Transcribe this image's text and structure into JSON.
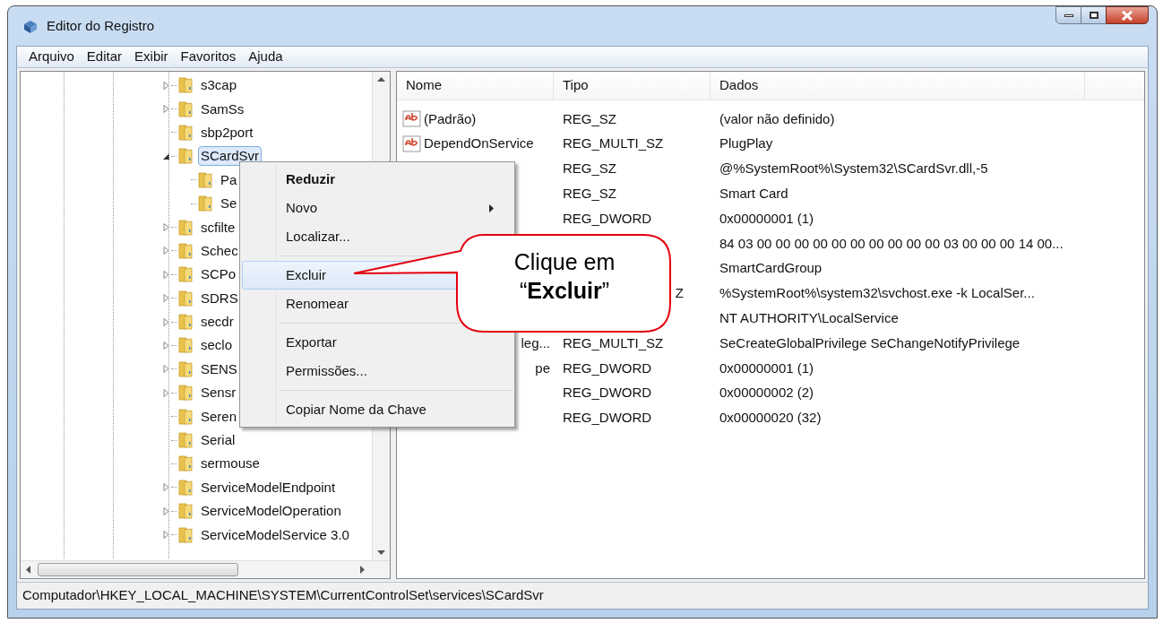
{
  "window": {
    "title": "Editor do Registro"
  },
  "menu_bar": [
    "Arquivo",
    "Editar",
    "Exibir",
    "Favoritos",
    "Ajuda"
  ],
  "tree": [
    {
      "label": "s3cap",
      "expanded": false,
      "selected": false
    },
    {
      "label": "SamSs",
      "expanded": false,
      "selected": false
    },
    {
      "label": "sbp2port",
      "selected": false
    },
    {
      "label": "SCardSvr",
      "expanded": true,
      "selected": true,
      "children": [
        {
          "label": "Pa",
          "selected": false
        },
        {
          "label": "Se",
          "selected": false
        }
      ]
    },
    {
      "label": "scfilte",
      "expanded": false,
      "selected": false
    },
    {
      "label": "Schec",
      "expanded": false,
      "selected": false
    },
    {
      "label": "SCPo",
      "expanded": false,
      "selected": false
    },
    {
      "label": "SDRS",
      "expanded": false,
      "selected": false
    },
    {
      "label": "secdr",
      "expanded": false,
      "selected": false
    },
    {
      "label": "seclo",
      "expanded": false,
      "selected": false
    },
    {
      "label": "SENS",
      "expanded": false,
      "selected": false
    },
    {
      "label": "Sensr",
      "expanded": false,
      "selected": false
    },
    {
      "label": "Seren",
      "selected": false
    },
    {
      "label": "Serial",
      "selected": false
    },
    {
      "label": "sermouse",
      "selected": false
    },
    {
      "label": "ServiceModelEndpoint",
      "expanded": false,
      "selected": false
    },
    {
      "label": "ServiceModelOperation",
      "expanded": false,
      "selected": false
    },
    {
      "label": "ServiceModelService 3.0",
      "expanded": false,
      "selected": false
    }
  ],
  "values": {
    "columns": [
      "Nome",
      "Tipo",
      "Dados"
    ],
    "rows": [
      {
        "kind": "string",
        "name": "(Padrão)",
        "type": "REG_SZ",
        "data": "(valor não definido)"
      },
      {
        "kind": "string",
        "name": "DependOnService",
        "type": "REG_MULTI_SZ",
        "data": "PlugPlay"
      },
      {
        "type": "REG_SZ",
        "data": "@%SystemRoot%\\System32\\SCardSvr.dll,-5"
      },
      {
        "type": "REG_SZ",
        "data": "Smart Card"
      },
      {
        "type": "REG_DWORD",
        "data": "0x00000001 (1)"
      },
      {
        "data": "84 03 00 00 00 00 00 00 00 00 00 00 03 00 00 00 14 00..."
      },
      {
        "data": "SmartCardGroup"
      },
      {
        "type": "Z",
        "data": "%SystemRoot%\\system32\\svchost.exe -k LocalSer..."
      },
      {
        "data": "NT AUTHORITY\\LocalService"
      },
      {
        "name": "leg...",
        "type": "REG_MULTI_SZ",
        "data": "SeCreateGlobalPrivilege SeChangeNotifyPrivilege"
      },
      {
        "name": "pe",
        "type": "REG_DWORD",
        "data": "0x00000001 (1)"
      },
      {
        "type": "REG_DWORD",
        "data": "0x00000002 (2)"
      },
      {
        "type": "REG_DWORD",
        "data": "0x00000020 (32)"
      }
    ]
  },
  "context_menu": [
    {
      "kind": "item",
      "label": "Reduzir",
      "default": true,
      "selected": false
    },
    {
      "kind": "item",
      "label": "Novo",
      "submenu": true,
      "selected": false
    },
    {
      "kind": "item",
      "label": "Localizar...",
      "selected": false
    },
    {
      "kind": "separator"
    },
    {
      "kind": "item",
      "label": "Excluir",
      "selected": true
    },
    {
      "kind": "item",
      "label": "Renomear",
      "selected": false
    },
    {
      "kind": "separator"
    },
    {
      "kind": "item",
      "label": "Exportar",
      "selected": false
    },
    {
      "kind": "item",
      "label": "Permissões...",
      "selected": false
    },
    {
      "kind": "separator"
    },
    {
      "kind": "item",
      "label": "Copiar Nome da Chave",
      "selected": false
    }
  ],
  "callout": {
    "text": "Clique em “**Excluir**”"
  },
  "status_bar": "Computador\\HKEY_LOCAL_MACHINE\\SYSTEM\\CurrentControlSet\\services\\SCardSvr"
}
